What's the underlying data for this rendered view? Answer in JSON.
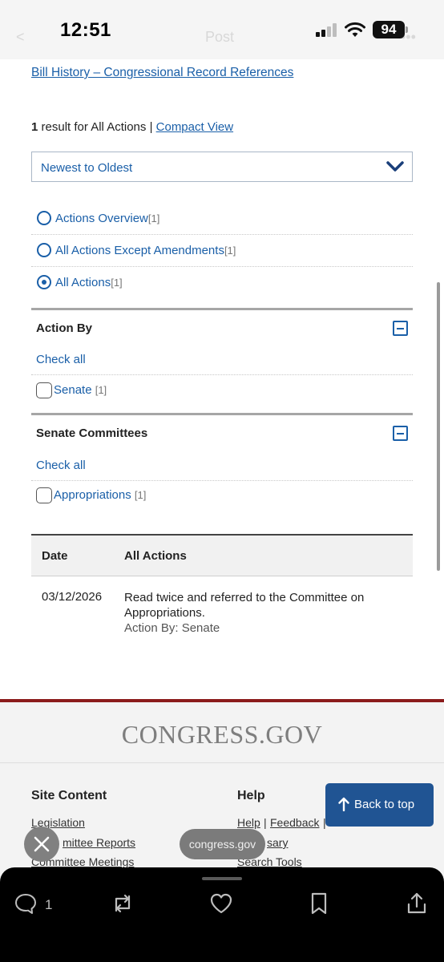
{
  "status_bar": {
    "time": "12:51",
    "battery": "94",
    "back_ghost": "<",
    "title_ghost": "Post",
    "menu_ghost": "•••"
  },
  "page": {
    "bill_history_link": "Bill History – Congressional Record References",
    "result_count": "1",
    "result_text": " result for All Actions | ",
    "compact_view_link": "Compact View",
    "sort": {
      "selected": "Newest to Oldest"
    },
    "action_filters": [
      {
        "label": "Actions Overview",
        "count": "[1]",
        "selected": false
      },
      {
        "label": "All Actions Except Amendments",
        "count": "[1]",
        "selected": false
      },
      {
        "label": "All Actions",
        "count": "[1]",
        "selected": true
      }
    ],
    "facets": [
      {
        "title": "Action By",
        "check_all": "Check all",
        "items": [
          {
            "label": "Senate",
            "count": "[1]"
          }
        ]
      },
      {
        "title": "Senate Committees",
        "check_all": "Check all",
        "items": [
          {
            "label": "Appropriations",
            "count": "[1]"
          }
        ]
      }
    ],
    "table": {
      "headers": [
        "Date",
        "All Actions"
      ],
      "rows": [
        {
          "date": "03/12/2026",
          "action": "Read twice and referred to the Committee on Appropriations.",
          "action_by": "Action By: Senate"
        }
      ]
    }
  },
  "footer": {
    "logo": "CONGRESS.GOV",
    "site_content": {
      "heading": "Site Content",
      "links": [
        "Legislation",
        "Committee Reports",
        "Committee Meetings"
      ],
      "visible_fragments": [
        "mittee Reports",
        "Committee Meetings"
      ]
    },
    "help": {
      "heading": "Help",
      "links": [
        "Help",
        "Feedback",
        "Glossary",
        "Search Tools"
      ],
      "visible_fragments": [
        "sary"
      ]
    },
    "separator": "|",
    "back_to_top": "Back to top"
  },
  "browser": {
    "url": "congress.gov"
  },
  "post_actions": {
    "reply_count": "1"
  }
}
